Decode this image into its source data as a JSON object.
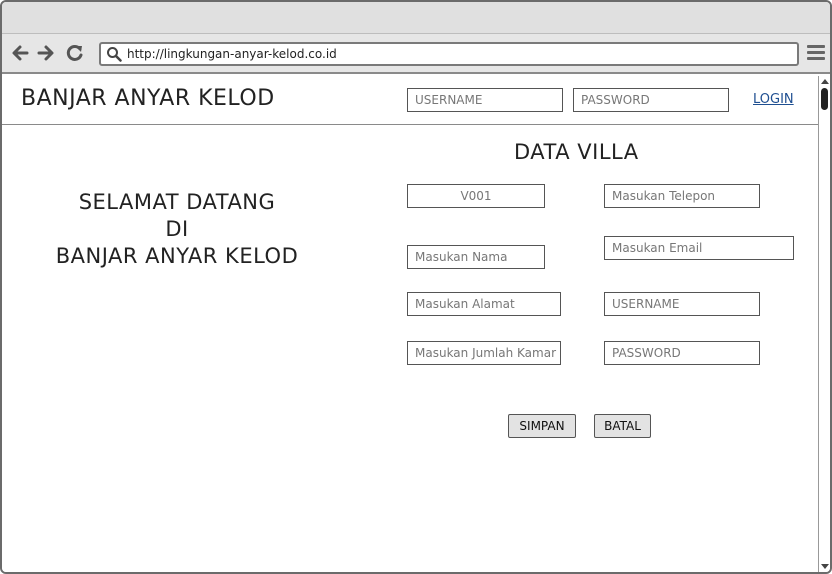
{
  "browser": {
    "url": "http://lingkungan-anyar-kelod.co.id"
  },
  "header": {
    "brand": "BANJAR ANYAR KELOD",
    "username_placeholder": "USERNAME",
    "password_placeholder": "PASSWORD",
    "login_label": "LOGIN"
  },
  "welcome": {
    "line1": "SELAMAT DATANG",
    "line2": "DI",
    "line3": "BANJAR ANYAR KELOD"
  },
  "form": {
    "title": "DATA VILLA",
    "id_value": "V001",
    "nama_placeholder": "Masukan Nama",
    "alamat_placeholder": "Masukan Alamat",
    "jumlah_kamar_placeholder": "Masukan Jumlah Kamar",
    "telepon_placeholder": "Masukan Telepon",
    "email_placeholder": "Masukan Email",
    "username_placeholder": "USERNAME",
    "password_placeholder": "PASSWORD",
    "simpan_label": "SIMPAN",
    "batal_label": "BATAL"
  },
  "icons": {
    "back": "arrow-left-icon",
    "forward": "arrow-right-icon",
    "reload": "reload-icon",
    "search": "search-icon",
    "menu": "hamburger-menu-icon"
  }
}
